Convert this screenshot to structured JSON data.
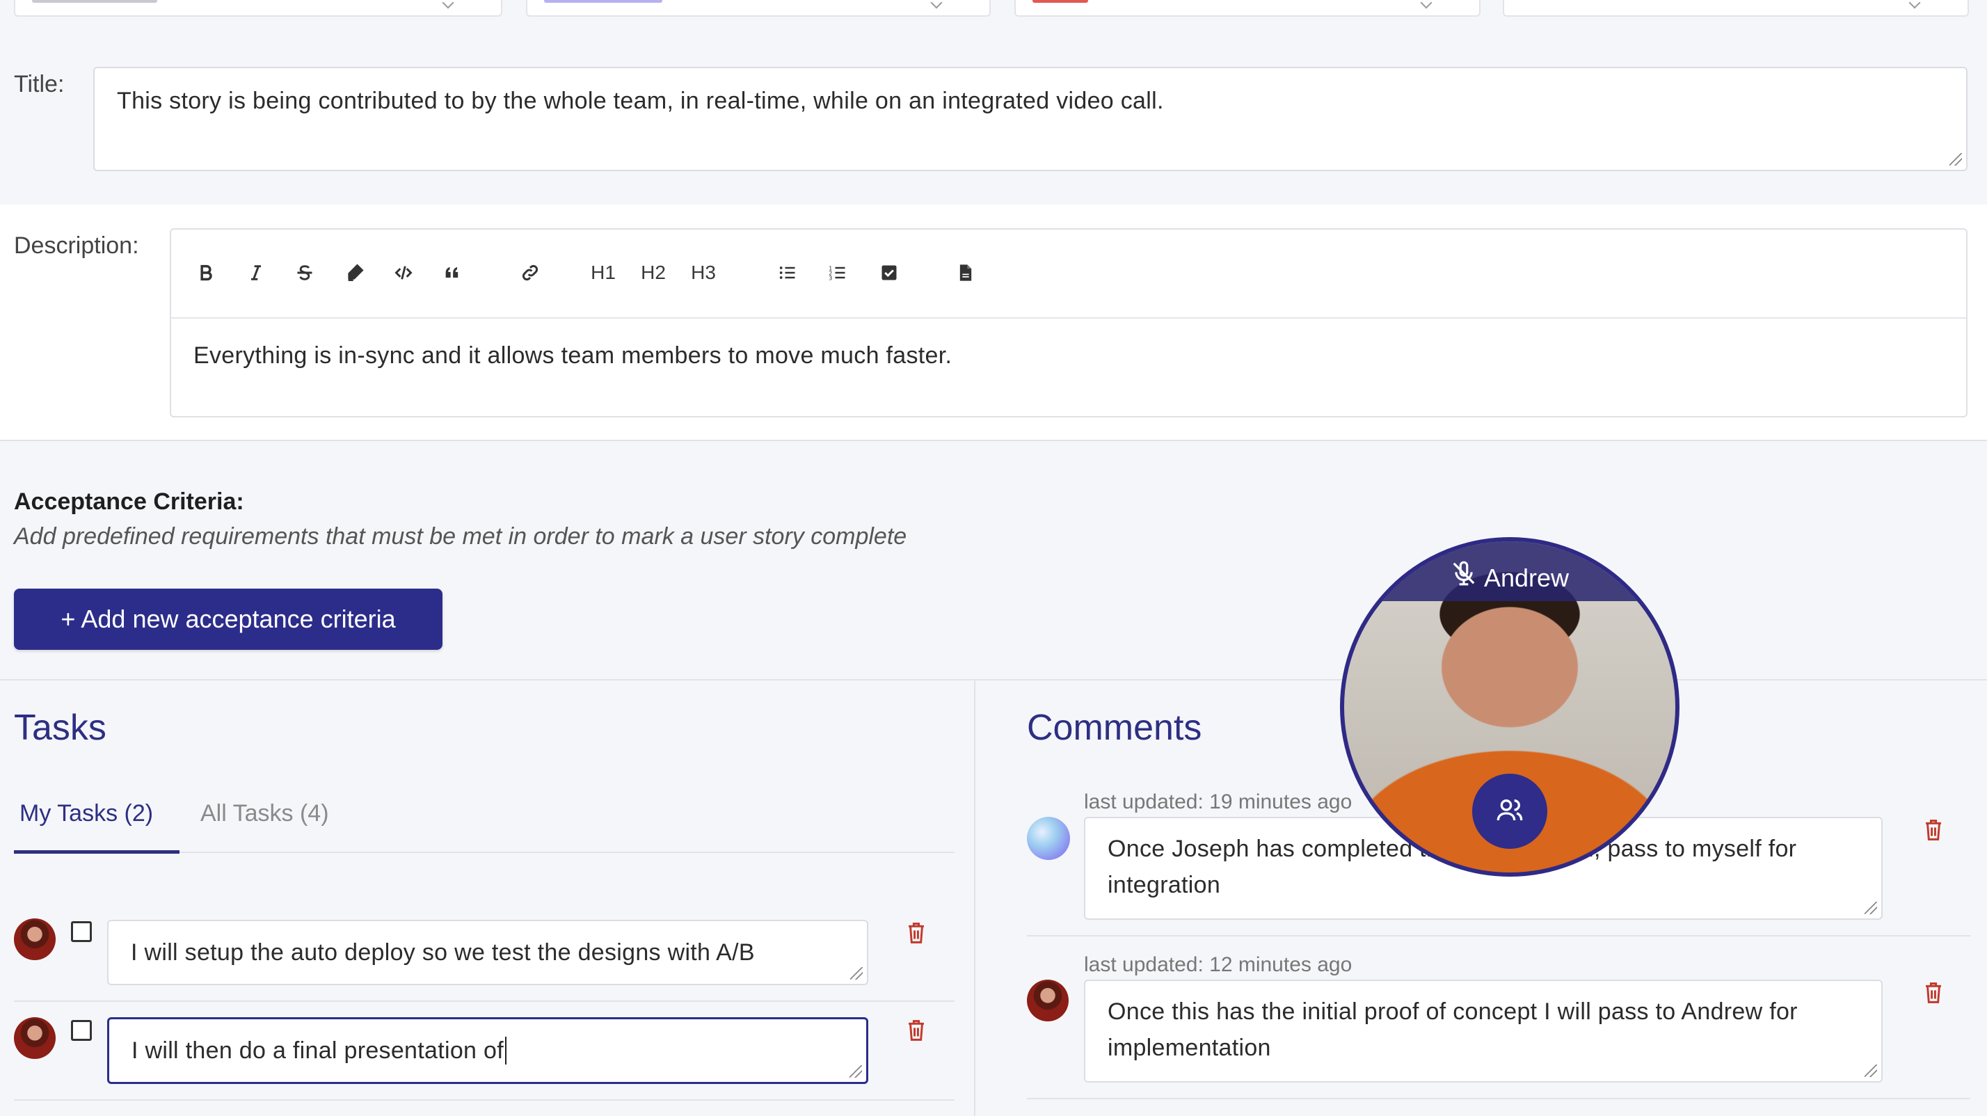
{
  "colors": {
    "primary": "#2c2d8a",
    "heading": "#2d2f82",
    "danger": "#c0392b",
    "background": "#f5f6fa"
  },
  "title_field": {
    "label": "Title:",
    "value": "This story is being contributed to by the whole team, in real-time, while on an integrated video call."
  },
  "description": {
    "label": "Description:",
    "toolbar": {
      "bold_icon": "bold-icon",
      "italic_icon": "italic-icon",
      "strike_icon": "strikethrough-icon",
      "highlight_icon": "highlighter-icon",
      "code_icon": "code-icon",
      "quote_icon": "quote-icon",
      "link_icon": "link-icon",
      "h1": "H1",
      "h2": "H2",
      "h3": "H3",
      "bullet_icon": "bullet-list-icon",
      "ordered_icon": "ordered-list-icon",
      "task_icon": "task-list-icon",
      "file_icon": "file-icon"
    },
    "value": "Everything is in-sync and it allows team members to move much faster."
  },
  "acceptance": {
    "title": "Acceptance Criteria:",
    "subtitle": "Add predefined requirements that must be met in order to mark a user story complete",
    "button": "+ Add new acceptance criteria"
  },
  "tasks": {
    "heading": "Tasks",
    "tabs": [
      {
        "label": "My Tasks (2)",
        "active": true
      },
      {
        "label": "All Tasks (4)",
        "active": false
      }
    ],
    "items": [
      {
        "text": "I will setup the auto deploy so we test the designs with A/B",
        "checked": false
      },
      {
        "text": "I will then do a final presentation of ",
        "checked": false,
        "focused": true
      }
    ]
  },
  "comments": {
    "heading": "Comments",
    "items": [
      {
        "meta": "last updated: 19 minutes ago",
        "text": "Once Joseph has completed the investigation, pass to myself for integration"
      },
      {
        "meta": "last updated: 12 minutes ago",
        "text": "Once this has the initial proof of concept I will pass to Andrew for implementation"
      }
    ]
  },
  "video": {
    "name": "Andrew",
    "mic_icon": "mic-off-icon",
    "participants_icon": "participants-icon"
  }
}
